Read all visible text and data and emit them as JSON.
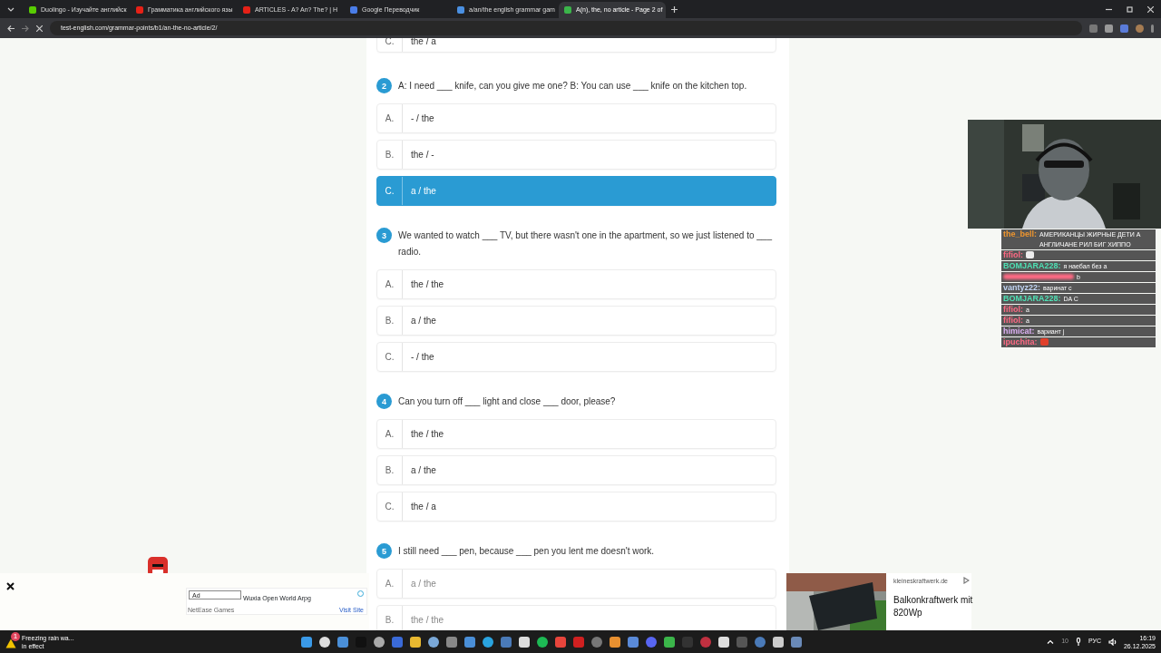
{
  "browser": {
    "tabs": [
      {
        "title": "Duolingo - Изучайте английск",
        "selected": false,
        "color": "#58cc02"
      },
      {
        "title": "Грамматика английского язы",
        "selected": false,
        "color": "#e62117"
      },
      {
        "title": "ARTICLES - A? An? The? | H",
        "selected": false,
        "color": "#e62117"
      },
      {
        "title": "Google Переводчик",
        "selected": false,
        "color": "#4a7de8"
      },
      {
        "title": "a/an/the english grammar gam",
        "selected": false,
        "color": "#4a90e2"
      },
      {
        "title": "A(n), the, no article - Page 2 of",
        "selected": true,
        "color": "#3bb54a"
      }
    ],
    "url": "test-english.com/grammar-points/b1/an-the-no-article/2/"
  },
  "quiz": {
    "partial_option": {
      "letter": "C.",
      "text": "the / a"
    },
    "questions": [
      {
        "number": "2",
        "text": "A: I need ___ knife, can you give me one? B: You can use ___ knife on the kitchen top.",
        "options": [
          {
            "letter": "A.",
            "text": "- / the",
            "selected": false
          },
          {
            "letter": "B.",
            "text": "the / -",
            "selected": false
          },
          {
            "letter": "C.",
            "text": "a / the",
            "selected": true
          }
        ]
      },
      {
        "number": "3",
        "text": "We wanted to watch ___ TV, but there wasn't one in the apartment, so we just listened to ___ radio.",
        "options": [
          {
            "letter": "A.",
            "text": "the / the",
            "selected": false
          },
          {
            "letter": "B.",
            "text": "a / the",
            "selected": false
          },
          {
            "letter": "C.",
            "text": "- / the",
            "selected": false
          }
        ]
      },
      {
        "number": "4",
        "text": "Can you turn off ___ light and close ___ door, please?",
        "options": [
          {
            "letter": "A.",
            "text": "the / the",
            "selected": false
          },
          {
            "letter": "B.",
            "text": "a / the",
            "selected": false
          },
          {
            "letter": "C.",
            "text": "the / a",
            "selected": false
          }
        ]
      },
      {
        "number": "5",
        "text": "I still need ___ pen, because ___ pen you lent me doesn't work.",
        "options": [
          {
            "letter": "A.",
            "text": "a / the",
            "selected": false
          },
          {
            "letter": "B.",
            "text": "the / the",
            "selected": false
          }
        ]
      }
    ]
  },
  "chat": [
    {
      "author": "the_bell:",
      "color": "#f0962e",
      "text": "АМЕРИКАНЦЫ ЖИРНЫЕ ДЕТИ А АНГЛИЧАНЕ РИЛ БИГ ХИППО"
    },
    {
      "author": "fifiol:",
      "color": "#ff6a84",
      "kind": "emote"
    },
    {
      "author": "BOMJARA228:",
      "color": "#4ee0b4",
      "text": "я наебал без а"
    },
    {
      "color": "#ff6a84",
      "text": "b"
    },
    {
      "author": "vantyz22:",
      "color": "#c0d4f4",
      "text": "варинат с"
    },
    {
      "author": "BOMJARA228:",
      "color": "#4ee0b4",
      "text": "DA C"
    },
    {
      "author": "fifiol:",
      "color": "#ff6a84",
      "text": "a"
    },
    {
      "author": "fifiol:",
      "color": "#ff6a84",
      "text": "a"
    },
    {
      "author": "himicat:",
      "color": "#dcb0f4",
      "text": "вариант j"
    },
    {
      "author": "ipuchita:",
      "color": "#ff6a84",
      "kind": "emote"
    }
  ],
  "ads": {
    "banner": {
      "badge": "Ad",
      "title": "Wuxia Open World Arpg",
      "advertiser": "NetEase Games",
      "cta": "Visit Site"
    },
    "native": {
      "domain": "kleineskraftwerk.de",
      "headline": "Balkonkraftwerk mit 820Wp"
    }
  },
  "taskbar": {
    "weather": {
      "title": "Freezing rain wa...",
      "subtitle": "in effect",
      "badge": "1"
    },
    "tray_count": "10",
    "language": "РУС",
    "time": "16:19",
    "date": "26.12.2025"
  }
}
